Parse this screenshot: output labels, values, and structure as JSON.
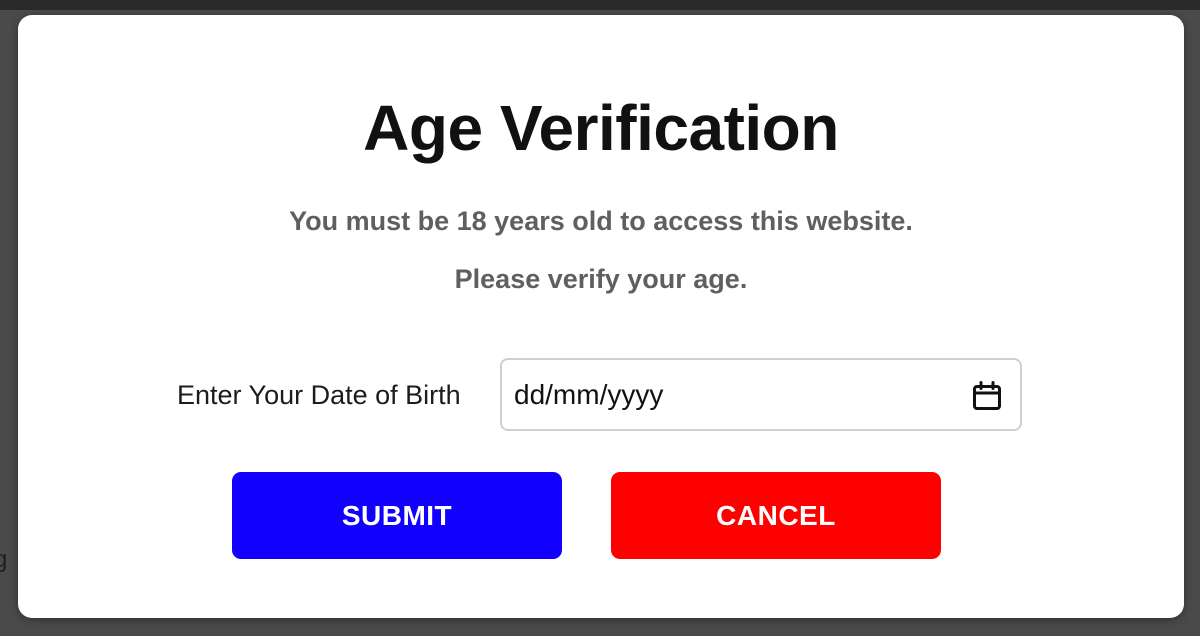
{
  "modal": {
    "title": "Age Verification",
    "message_line1": "You must be 18 years old to access this website.",
    "message_line2": "Please verify your age."
  },
  "dob": {
    "label": "Enter Your Date of Birth",
    "placeholder": "dd/mm/yyyy",
    "icon": "calendar-icon"
  },
  "buttons": {
    "submit_label": "SUBMIT",
    "cancel_label": "CANCEL"
  },
  "colors": {
    "submit": "#1200ff",
    "cancel": "#ff0000",
    "backdrop": "#4a4a4a",
    "modal_bg": "#ffffff",
    "message_text": "#5f5f5f"
  },
  "background": {
    "partial_text": "g"
  }
}
